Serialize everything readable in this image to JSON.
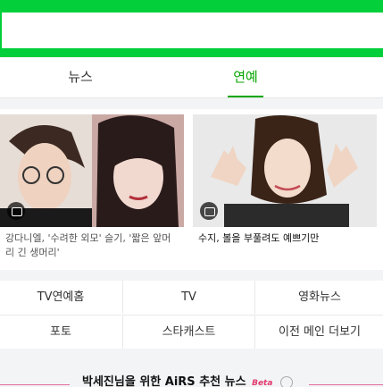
{
  "tabs": [
    {
      "label": "뉴스"
    },
    {
      "label": "연예",
      "active": true
    }
  ],
  "cards": [
    {
      "caption": "강다니엘, '수려한 외모' 슬기, '짧은 앞머리 긴 생머리'"
    },
    {
      "caption": "수지, 볼을 부풀려도 예쁘기만"
    }
  ],
  "links": {
    "row1": [
      "TV연예홈",
      "TV",
      "영화뉴스"
    ],
    "row2": [
      "포토",
      "스타캐스트",
      "이전 메인 더보기"
    ]
  },
  "recommend": {
    "title": "박세진님을 위한 AiRS 추천 뉴스",
    "beta": "Beta"
  },
  "colors": {
    "brand": "#03cf3a",
    "active": "#08a600",
    "accent": "#e36b9b"
  },
  "icons": {
    "photo_badge": "camera-icon",
    "info": "info-icon"
  }
}
